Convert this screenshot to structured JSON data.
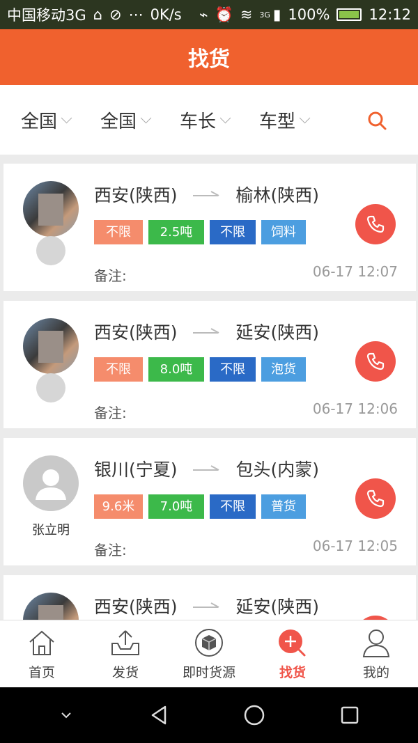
{
  "status_bar": {
    "carrier": "中国移动3G",
    "speed": "0K/s",
    "network": "3G",
    "battery": "100%",
    "time": "12:12"
  },
  "header": {
    "title": "找货"
  },
  "filters": [
    {
      "label": "全国"
    },
    {
      "label": "全国"
    },
    {
      "label": "车长"
    },
    {
      "label": "车型"
    }
  ],
  "cards": [
    {
      "name": "",
      "from": "西安(陕西)",
      "to": "榆林(陕西)",
      "tags": [
        "不限",
        "2.5吨",
        "不限",
        "饲料"
      ],
      "note_label": "备注:",
      "time": "06-17 12:07"
    },
    {
      "name": "",
      "from": "西安(陕西)",
      "to": "延安(陕西)",
      "tags": [
        "不限",
        "8.0吨",
        "不限",
        "泡货"
      ],
      "note_label": "备注:",
      "time": "06-17 12:06"
    },
    {
      "name": "张立明",
      "from": "银川(宁夏)",
      "to": "包头(内蒙)",
      "tags": [
        "9.6米",
        "7.0吨",
        "不限",
        "普货"
      ],
      "note_label": "备注:",
      "time": "06-17 12:05"
    },
    {
      "name": "",
      "from": "西安(陕西)",
      "to": "延安(陕西)",
      "tags": [],
      "note_label": "",
      "time": ""
    }
  ],
  "tabs": [
    {
      "label": "首页",
      "icon": "home-icon"
    },
    {
      "label": "发货",
      "icon": "upload-icon"
    },
    {
      "label": "即时货源",
      "icon": "box-icon"
    },
    {
      "label": "找货",
      "icon": "search-plus-icon"
    },
    {
      "label": "我的",
      "icon": "user-icon"
    }
  ],
  "colors": {
    "accent": "#f0612e",
    "call": "#f0554a",
    "tag_length": "#f58c6c",
    "tag_weight": "#3cb94a",
    "tag_type": "#2a6ac6",
    "tag_cargo": "#4c9ee0"
  }
}
